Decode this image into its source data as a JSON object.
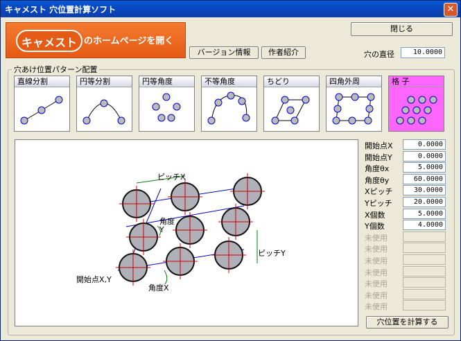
{
  "window": {
    "title": "キャメスト 穴位置計算ソフト",
    "close_icon": "close-icon"
  },
  "logo": {
    "brand": "キャメスト",
    "caption": "のホームページを開く"
  },
  "buttons": {
    "close": "閉じる",
    "version": "バージョン情報",
    "author": "作者紹介",
    "calculate": "穴位置を計算する"
  },
  "hole_diameter": {
    "label": "穴の直径",
    "value": "10.0000"
  },
  "pattern_group": {
    "title": "穴あけ位置パターン配置"
  },
  "patterns": [
    {
      "label": "直線分割",
      "selected": false
    },
    {
      "label": "円等分割",
      "selected": false
    },
    {
      "label": "円等角度",
      "selected": false
    },
    {
      "label": "不等角度",
      "selected": false
    },
    {
      "label": "ちどり",
      "selected": false
    },
    {
      "label": "四角外周",
      "selected": false
    },
    {
      "label": "格 子",
      "selected": true
    }
  ],
  "diagram": {
    "pitch_x": "ピッチX",
    "pitch_y": "ピッチY",
    "angle_y": "角度\nY",
    "angle_x": "角度X",
    "start": "開始点X,Y"
  },
  "params": [
    {
      "label": "開始点X",
      "value": "0.0000",
      "enabled": true
    },
    {
      "label": "開始点Y",
      "value": "0.0000",
      "enabled": true
    },
    {
      "label": "角度θx",
      "value": "5.0000",
      "enabled": true
    },
    {
      "label": "角度θy",
      "value": "60.0000",
      "enabled": true
    },
    {
      "label": "Xピッチ",
      "value": "30.0000",
      "enabled": true
    },
    {
      "label": "Yピッチ",
      "value": "20.0000",
      "enabled": true
    },
    {
      "label": "X個数",
      "value": "5.0000",
      "enabled": true
    },
    {
      "label": "Y個数",
      "value": "4.0000",
      "enabled": true
    },
    {
      "label": "未使用",
      "value": "",
      "enabled": false
    },
    {
      "label": "未使用",
      "value": "",
      "enabled": false
    },
    {
      "label": "未使用",
      "value": "",
      "enabled": false
    },
    {
      "label": "未使用",
      "value": "",
      "enabled": false
    },
    {
      "label": "未使用",
      "value": "",
      "enabled": false
    },
    {
      "label": "未使用",
      "value": "",
      "enabled": false
    },
    {
      "label": "未使用",
      "value": "",
      "enabled": false
    }
  ]
}
